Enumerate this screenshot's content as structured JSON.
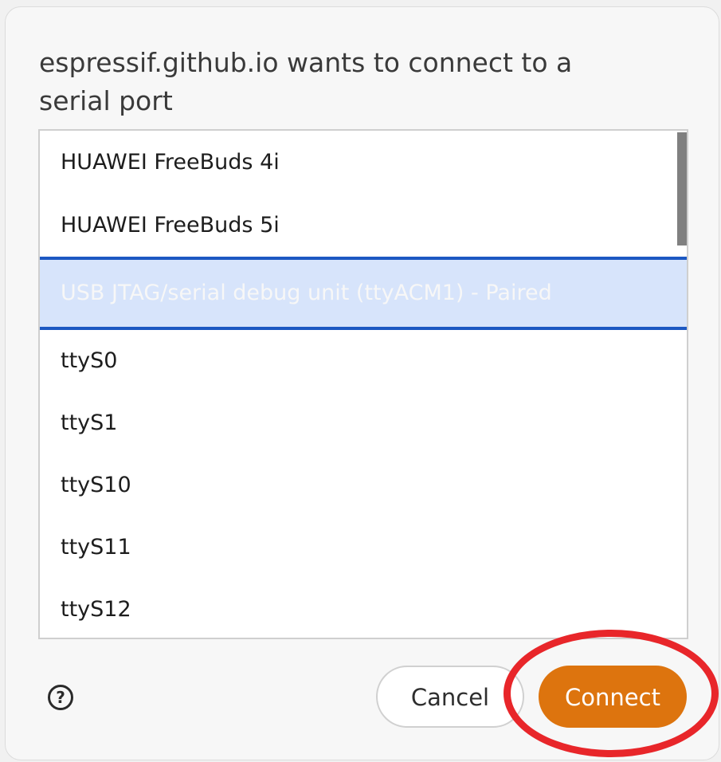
{
  "dialog": {
    "title": "espressif.github.io wants to connect to a serial port"
  },
  "ports": [
    {
      "label": "HUAWEI FreeBuds 4i"
    },
    {
      "label": "HUAWEI FreeBuds 5i"
    },
    {
      "label": "USB JTAG/serial debug unit (ttyACM1) - Paired",
      "selected": true
    },
    {
      "label": "ttyS0"
    },
    {
      "label": "ttyS1"
    },
    {
      "label": "ttyS10"
    },
    {
      "label": "ttyS11"
    },
    {
      "label": "ttyS12"
    }
  ],
  "buttons": {
    "help_icon": "question-circle",
    "help_glyph": "?",
    "cancel": "Cancel",
    "connect": "Connect"
  },
  "colors": {
    "accent": "#dd740e",
    "selection": "#d7e4fb",
    "selection_border": "#1c58c2",
    "annotation": "#e8262a"
  }
}
